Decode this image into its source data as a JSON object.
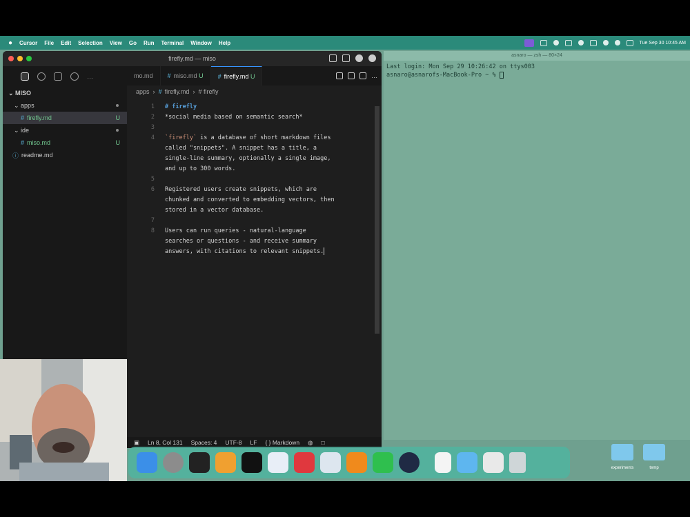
{
  "menubar": {
    "items": [
      "Cursor",
      "File",
      "Edit",
      "Selection",
      "View",
      "Go",
      "Run",
      "Terminal",
      "Window",
      "Help"
    ],
    "datetime": "Tue Sep 30 10:45 AM"
  },
  "editor": {
    "window_title": "firefly.md — miso",
    "sidebar": {
      "root": "MISO",
      "items": [
        {
          "label": "apps",
          "type": "folder",
          "badge": "dot"
        },
        {
          "label": "firefly.md",
          "type": "file",
          "badge": "U"
        },
        {
          "label": "ide",
          "type": "folder",
          "badge": "dot"
        },
        {
          "label": "miso.md",
          "type": "file",
          "badge": "U"
        },
        {
          "label": "readme.md",
          "type": "file",
          "badge": ""
        }
      ]
    },
    "tabs": [
      {
        "label": "mo.md",
        "badge": ""
      },
      {
        "label": "miso.md",
        "badge": "U"
      },
      {
        "label": "firefly.md",
        "badge": "U"
      }
    ],
    "breadcrumb": {
      "folder": "apps",
      "file": "firefly.md",
      "symbol": "# firefly"
    },
    "code_lines": [
      {
        "num": "1",
        "text": "# firefly",
        "kind": "heading"
      },
      {
        "num": "2",
        "text": "*social media based on semantic search*",
        "kind": "text"
      },
      {
        "num": "3",
        "text": "",
        "kind": "text"
      },
      {
        "num": "4",
        "text": "`firefly` is a database of short markdown files",
        "kind": "code"
      },
      {
        "num": "",
        "text": "called \"snippets\". A snippet has a title, a",
        "kind": "text"
      },
      {
        "num": "",
        "text": "single-line summary, optionally a single image,",
        "kind": "text"
      },
      {
        "num": "",
        "text": "and up to 300 words.",
        "kind": "text"
      },
      {
        "num": "5",
        "text": "",
        "kind": "text"
      },
      {
        "num": "6",
        "text": "Registered users create snippets, which are",
        "kind": "text"
      },
      {
        "num": "",
        "text": "chunked and converted to embedding vectors, then",
        "kind": "text"
      },
      {
        "num": "",
        "text": "stored in a vector database.",
        "kind": "text"
      },
      {
        "num": "7",
        "text": "",
        "kind": "text"
      },
      {
        "num": "8",
        "text": "Users can run queries - natural-language",
        "kind": "text"
      },
      {
        "num": "",
        "text": "searches or questions - and receive summary",
        "kind": "text"
      },
      {
        "num": "",
        "text": "answers, with citations to relevant snippets.",
        "kind": "text"
      }
    ],
    "status": {
      "position": "Ln 8, Col 131",
      "spaces": "Spaces: 4",
      "encoding": "UTF-8",
      "eol": "LF",
      "language": "Markdown"
    }
  },
  "terminal": {
    "title": "asnaro — zsh — 80×24",
    "lines": [
      "Last login: Mon Sep 29 10:26:42 on ttys003",
      "asnaro@asnarofs-MacBook-Pro ~ % "
    ]
  },
  "desktop": {
    "folders": [
      {
        "label": "experiments"
      },
      {
        "label": "temp"
      }
    ]
  },
  "dock": {
    "apps": [
      {
        "name": "finder-icon",
        "color": "#3b8fe8"
      },
      {
        "name": "settings-icon",
        "color": "#8c8c8c"
      },
      {
        "name": "terminal-app-icon",
        "color": "#222222"
      },
      {
        "name": "pencil-app-icon",
        "color": "#f0a030"
      },
      {
        "name": "cursor-app-icon",
        "color": "#111111"
      },
      {
        "name": "star-app-icon",
        "color": "#e8eef7"
      },
      {
        "name": "red-app-icon",
        "color": "#e0383e"
      },
      {
        "name": "preview-app-icon",
        "color": "#dde6ef"
      },
      {
        "name": "vlc-icon",
        "color": "#f08a1c"
      },
      {
        "name": "whatsapp-icon",
        "color": "#2fbf4e"
      },
      {
        "name": "activity-app-icon",
        "color": "#1f2a44"
      },
      {
        "name": "document-icon",
        "color": "#f4f4f4"
      },
      {
        "name": "folder-icon",
        "color": "#5eb6ef"
      },
      {
        "name": "mail-app-icon",
        "color": "#e9e9e9"
      },
      {
        "name": "trash-icon",
        "color": "#cfd6d8"
      }
    ]
  },
  "colors": {
    "accent": "#3794ff",
    "untracked": "#73c991",
    "heading": "#569cd6",
    "inline_code": "#ce9178"
  }
}
